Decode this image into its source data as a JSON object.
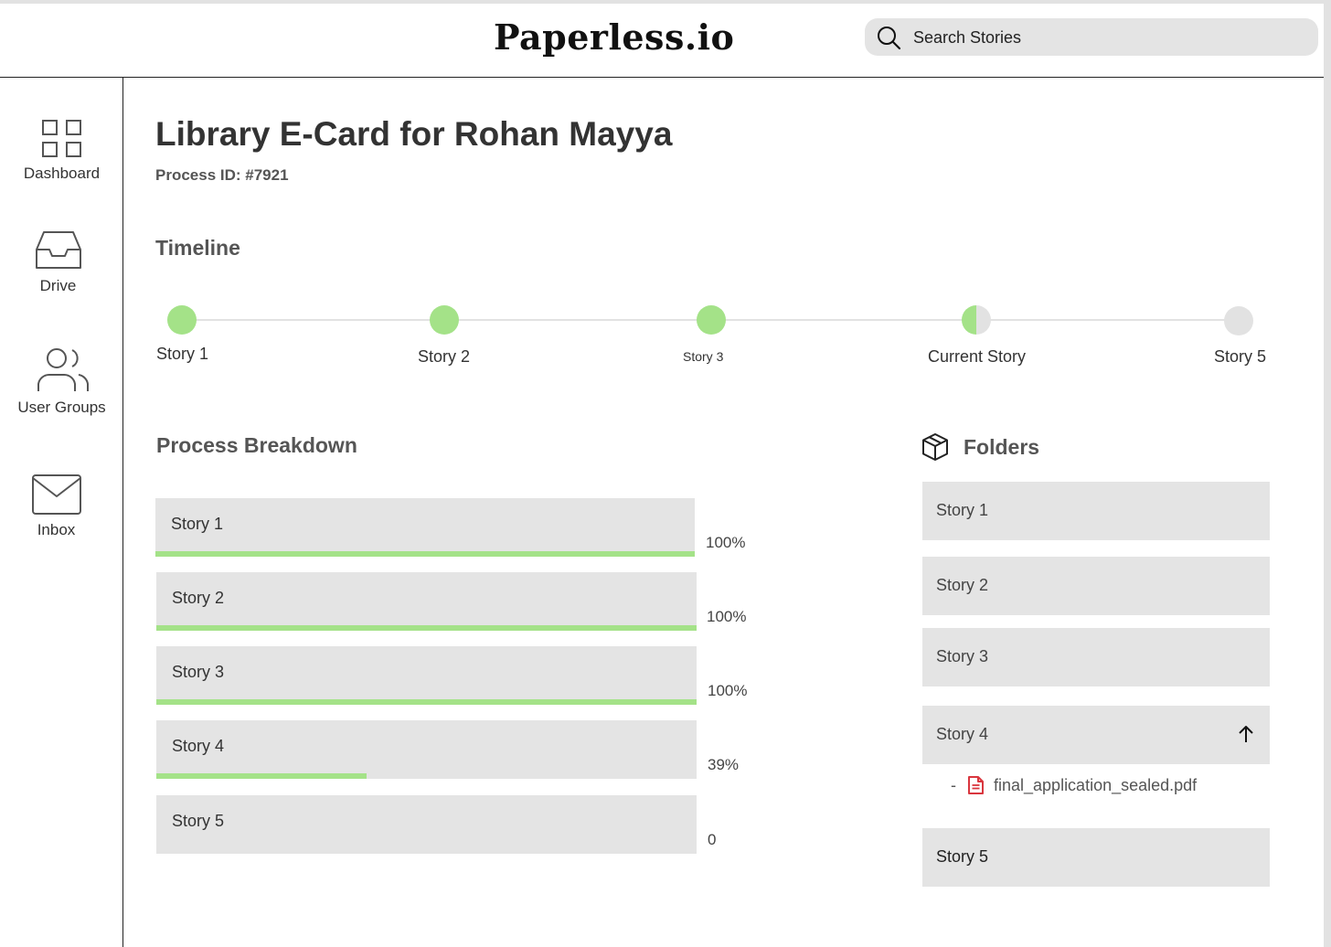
{
  "app": {
    "logo": "Paperless.io"
  },
  "search": {
    "placeholder": "Search Stories",
    "icon": "search-icon"
  },
  "sidebar": {
    "items": [
      {
        "label": "Dashboard",
        "icon": "grid-icon"
      },
      {
        "label": "Drive",
        "icon": "inbox-tray-icon"
      },
      {
        "label": "User Groups",
        "icon": "users-icon"
      },
      {
        "label": "Inbox",
        "icon": "mail-icon"
      }
    ]
  },
  "page": {
    "title": "Library E-Card for Rohan Mayya",
    "process_id": "Process ID: #7921"
  },
  "timeline": {
    "heading": "Timeline",
    "steps": [
      {
        "label": "Story 1",
        "status": "complete"
      },
      {
        "label": "Story 2",
        "status": "complete"
      },
      {
        "label": "Story 3",
        "status": "complete"
      },
      {
        "label": "Current Story",
        "status": "in-progress"
      },
      {
        "label": "Story 5",
        "status": "pending"
      }
    ]
  },
  "breakdown": {
    "heading": "Process Breakdown",
    "rows": [
      {
        "label": "Story 1",
        "percent_text": "100%",
        "progress": 1.0
      },
      {
        "label": "Story 2",
        "percent_text": "100%",
        "progress": 1.0
      },
      {
        "label": "Story 3",
        "percent_text": "100%",
        "progress": 1.0
      },
      {
        "label": "Story 4",
        "percent_text": "39%",
        "progress": 0.39
      },
      {
        "label": "Story 5",
        "percent_text": "0",
        "progress": 0
      }
    ]
  },
  "folders": {
    "heading": "Folders",
    "icon": "box-icon",
    "items": [
      {
        "label": "Story 1"
      },
      {
        "label": "Story 2"
      },
      {
        "label": "Story 3"
      },
      {
        "label": "Story 4",
        "expanded": true,
        "toggle_icon": "arrow-up-icon"
      },
      {
        "label": "Story 5"
      }
    ],
    "open_file": {
      "prefix": "-",
      "name": "final_application_sealed.pdf",
      "icon": "pdf-file-icon"
    }
  },
  "colors": {
    "progress": "#a4e288",
    "pending": "#e2e2e2",
    "panel": "#e4e4e4",
    "file_icon": "#d9363e"
  }
}
